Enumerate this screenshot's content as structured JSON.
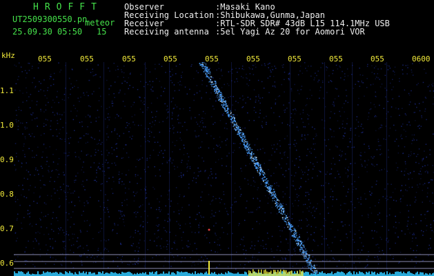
{
  "header": {
    "title": "HROFFT",
    "filename": "UT2509300550.pn",
    "mode": "meteor",
    "datetime": "25.09.30 05:50",
    "count": "15"
  },
  "info": [
    {
      "label": "Observer",
      "value": ":Masaki Kano"
    },
    {
      "label": "Receiving Location",
      "value": ":Shibukawa,Gunma,Japan"
    },
    {
      "label": "Receiver",
      "value": ":RTL-SDR SDR# 43dB L15 114.1MHz USB"
    },
    {
      "label": "Receiving antenna",
      "value": ":5el Yagi Az 20 for Aomori VOR"
    }
  ],
  "axes": {
    "y_unit": "kHz",
    "y_ticks": [
      "1.1",
      "1.0",
      "0.9",
      "0.8",
      "0.7",
      "0.6"
    ],
    "x_ticks": [
      "055",
      "055",
      "055",
      "055",
      "055",
      "055",
      "055",
      "055",
      "055",
      "0600"
    ]
  },
  "colors": {
    "background": "#000000",
    "header_text": "#45e24a",
    "info_text": "#f0f0f0",
    "axis_text": "#f2ea3a",
    "noise": "#1a2a8a",
    "echo": "#4aa0ff",
    "baseline": "#30c8ff"
  }
}
